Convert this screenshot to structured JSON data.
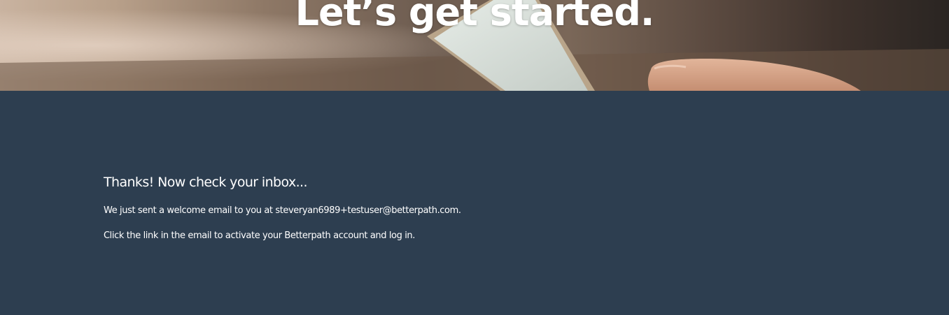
{
  "hero": {
    "title": "Let’s get started."
  },
  "confirmation": {
    "heading": "Thanks! Now check your inbox...",
    "sent_message": "We just sent a welcome email to you at steveryan6989+testuser@betterpath.com.",
    "activate_message": "Click the link in the email to activate your Betterpath account and log in."
  },
  "colors": {
    "background": "#2d3e50",
    "text": "#ffffff"
  }
}
